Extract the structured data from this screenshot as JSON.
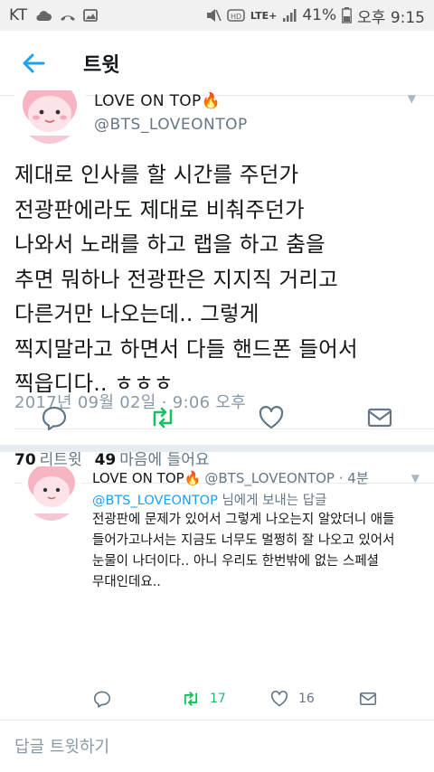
{
  "statusbar": {
    "carrier": "KT",
    "network": "LTE+",
    "battery": "41%",
    "time": "오후 9:15"
  },
  "header": {
    "title": "트윗"
  },
  "tweet": {
    "display_name": "LOVE ON TOP🔥",
    "handle": "@BTS_LOVEONTOP",
    "text_lines": [
      "제대로 인사를 할 시간를 주던가",
      "전광판에라도 제대로 비춰주던가",
      "나와서 노래를 하고 랩을 하고 춤을",
      "추면 뭐하나 전광판은 지지직 거리고",
      "다른거만 나오는데.. 그렇게",
      "찍지말라고 하면서 다들 핸드폰 들어서",
      "찍읍디다.. ㅎㅎㅎ"
    ],
    "timestamp": "2017년 09월 02일 · 9:06 오후",
    "retweet_count": "70",
    "retweet_label": "리트윗",
    "like_count": "49",
    "like_label": "마음에 들어요"
  },
  "reply": {
    "display_name": "LOVE ON TOP🔥",
    "meta": "@BTS_LOVEONTOP · 4분",
    "reply_to_mention": "@BTS_LOVEONTOP",
    "reply_to_suffix": " 님에게 보내는 답글",
    "text_lines": [
      "전광판에 문제가 있어서 그렇게 나오는지 알았더니 애들",
      "들어가고나서는 지금도 너무도 멀쩡히 잘 나오고 있어서",
      "눈물이 나더이다.. 아니 우리도 한번밖에 없는 스페셜",
      "무대인데요.."
    ],
    "retweet_count": "17",
    "like_count": "16"
  },
  "reply_box": {
    "placeholder": "답글 트윗하기"
  },
  "colors": {
    "accent": "#1da1f2",
    "retweet_green": "#17bf63",
    "muted": "#657786"
  },
  "icons": {
    "back": "arrow-left-icon",
    "reply": "reply-icon",
    "retweet": "retweet-icon",
    "like": "heart-icon",
    "dm": "envelope-icon"
  }
}
